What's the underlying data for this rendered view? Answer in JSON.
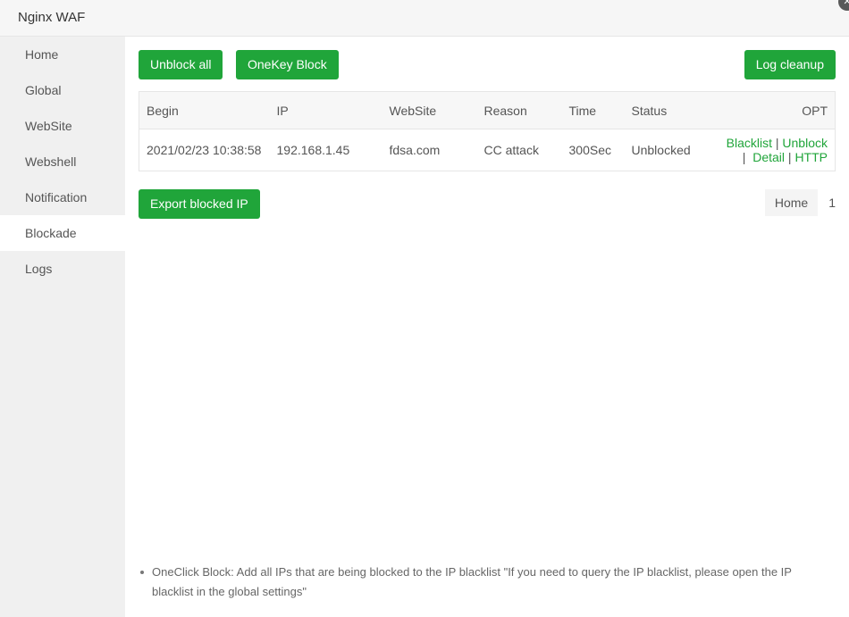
{
  "window": {
    "title": "Nginx WAF",
    "close_glyph": "✕"
  },
  "sidebar": {
    "items": [
      {
        "label": "Home"
      },
      {
        "label": "Global"
      },
      {
        "label": "WebSite"
      },
      {
        "label": "Webshell"
      },
      {
        "label": "Notification"
      },
      {
        "label": "Blockade",
        "active": true
      },
      {
        "label": "Logs"
      }
    ]
  },
  "toolbar": {
    "unblock_all": "Unblock all",
    "onekey_block": "OneKey Block",
    "log_cleanup": "Log cleanup"
  },
  "table": {
    "headers": {
      "begin": "Begin",
      "ip": "IP",
      "website": "WebSite",
      "reason": "Reason",
      "time": "Time",
      "status": "Status",
      "opt": "OPT"
    },
    "rows": [
      {
        "begin": "2021/02/23 10:38:58",
        "ip": "192.168.1.45",
        "website": "fdsa.com",
        "reason": "CC attack",
        "time": "300Sec",
        "status": "Unblocked",
        "actions": {
          "blacklist": "Blacklist",
          "unblock": "Unblock",
          "detail": "Detail",
          "http": "HTTP",
          "sep": "|"
        }
      }
    ]
  },
  "export_button": "Export blocked IP",
  "pager": {
    "home": "Home",
    "current": "1"
  },
  "tips": [
    "OneClick Block: Add all IPs that are being blocked to the IP blacklist \"If you need to query the IP blacklist, please open the IP blacklist in the global settings\""
  ],
  "colors": {
    "accent": "#20a53a",
    "sidebar_bg": "#f0f0f0"
  }
}
